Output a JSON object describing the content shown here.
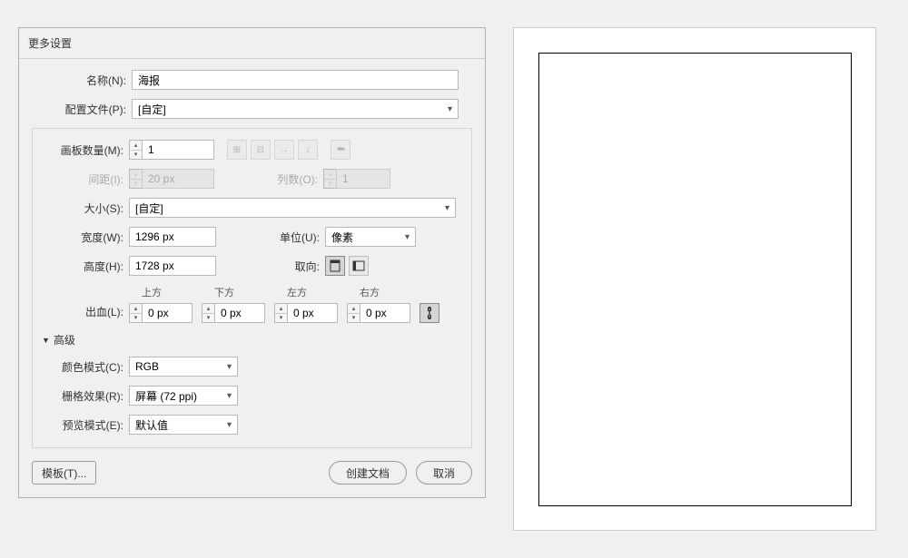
{
  "dialog": {
    "title": "更多设置"
  },
  "name": {
    "label": "名称(N):",
    "value": "海报"
  },
  "profile": {
    "label": "配置文件(P):",
    "value": "[自定]"
  },
  "artboards": {
    "label": "画板数量(M):",
    "value": "1",
    "spacing_label": "间距(I):",
    "spacing_value": "20 px",
    "columns_label": "列数(O):",
    "columns_value": "1"
  },
  "size": {
    "label": "大小(S):",
    "value": "[自定]"
  },
  "width": {
    "label": "宽度(W):",
    "value": "1296 px"
  },
  "height": {
    "label": "高度(H):",
    "value": "1728 px"
  },
  "units": {
    "label": "单位(U):",
    "value": "像素"
  },
  "orientation": {
    "label": "取向:"
  },
  "bleed": {
    "label": "出血(L):",
    "top_label": "上方",
    "bottom_label": "下方",
    "left_label": "左方",
    "right_label": "右方",
    "top": "0 px",
    "bottom": "0 px",
    "left": "0 px",
    "right": "0 px"
  },
  "advanced": {
    "label": "高级"
  },
  "color_mode": {
    "label": "颜色模式(C):",
    "value": "RGB"
  },
  "raster": {
    "label": "栅格效果(R):",
    "value": "屏幕 (72 ppi)"
  },
  "preview_mode": {
    "label": "预览模式(E):",
    "value": "默认值"
  },
  "buttons": {
    "template": "模板(T)...",
    "create": "创建文档",
    "cancel": "取消"
  }
}
